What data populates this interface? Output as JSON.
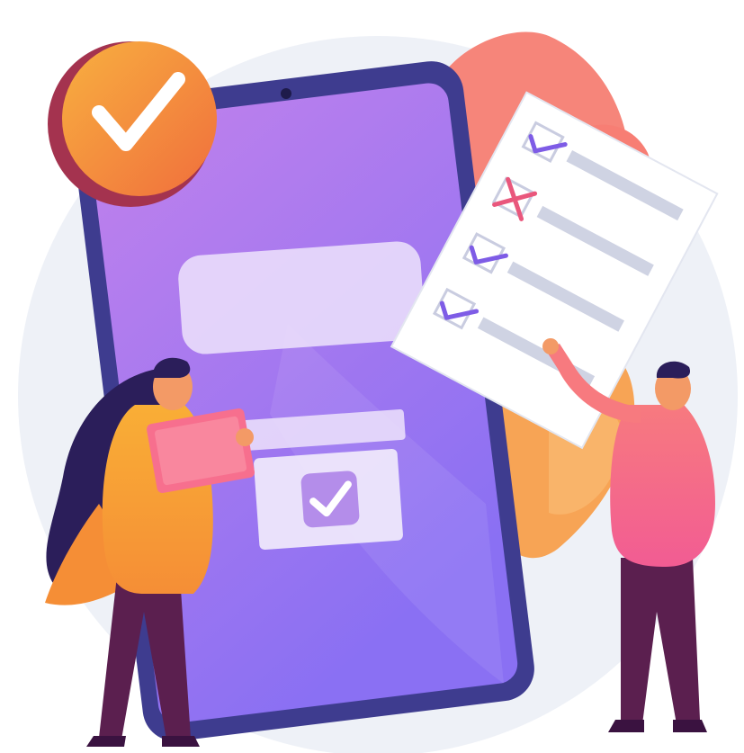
{
  "illustration": {
    "theme": "mobile checklist / survey approval",
    "colors": {
      "background_circle": "#EEF1F7",
      "phone_frame": "#3E3C8F",
      "phone_screen_top": "#B67BEA",
      "phone_screen_bottom": "#8C72F2",
      "accent_orange": "#F6A23A",
      "badge_orange": "#F39B3A",
      "badge_dark": "#A4334F",
      "leaf_pink": "#F6857A",
      "leaf_orange": "#F7A455",
      "paper": "#FFFFFF",
      "check_purple": "#7E5CE6",
      "cross_pink": "#E9577C",
      "line_gray": "#CFD3E3",
      "pants_purple": "#5B1F4F",
      "man_shirt": "#F66B88",
      "woman_shirt": "#F8A834",
      "skin": "#F39A66",
      "hair_dark": "#2B1E5A"
    },
    "icons": {
      "badge": "checkmark-badge-icon",
      "screen_checkbox": "checkbox-checked-icon",
      "list_checks": [
        "check-icon",
        "cross-icon",
        "check-icon",
        "check-icon"
      ]
    },
    "checklist_states": [
      "checked",
      "crossed",
      "checked",
      "checked"
    ]
  }
}
